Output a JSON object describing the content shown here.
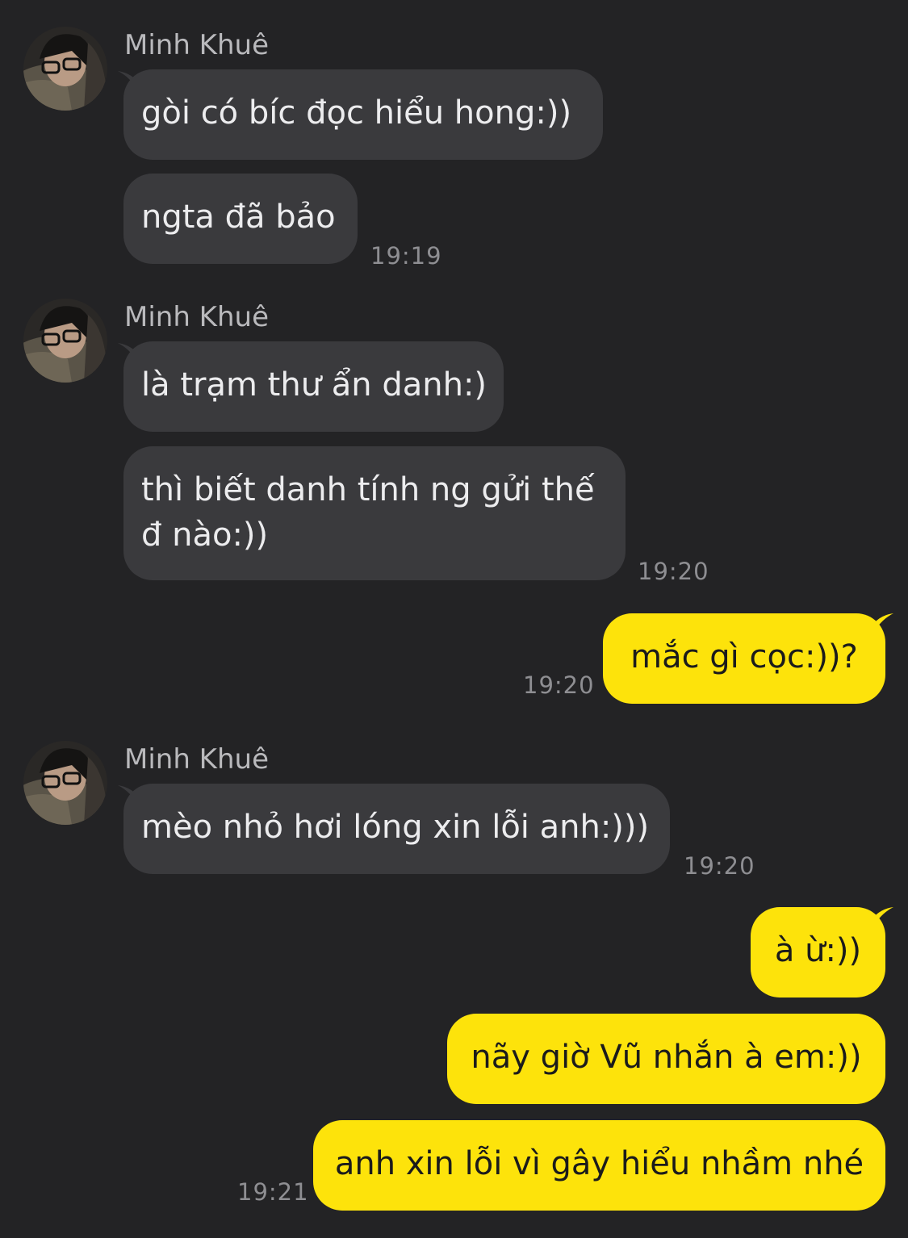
{
  "chat": {
    "sender_name": "Minh Khuê",
    "groups": [
      {
        "messages": [
          "gòi có bíc đọc hiểu hong:))",
          "ngta đã bảo"
        ],
        "time": "19:19"
      },
      {
        "messages": [
          "là trạm thư ẩn danh:)",
          "thì biết danh tính ng gửi thế đ nào:))"
        ],
        "time": "19:20"
      },
      {
        "messages": [
          "mèo nhỏ hơi lóng xin lỗi anh:)))"
        ],
        "time": "19:20"
      }
    ],
    "outgoing": [
      {
        "messages": [
          "mắc gì cọc:))?"
        ],
        "time": "19:20"
      },
      {
        "messages": [
          "à ừ:))",
          "nãy giờ Vũ nhắn à em:))",
          "anh xin lỗi vì gây hiểu nhầm nhé"
        ],
        "time": "19:21"
      }
    ]
  },
  "colors": {
    "background": "#232325",
    "incoming_bubble": "#3a3a3d",
    "outgoing_bubble": "#fde30b"
  },
  "icons": {
    "avatar": "avatar-photo-icon"
  }
}
